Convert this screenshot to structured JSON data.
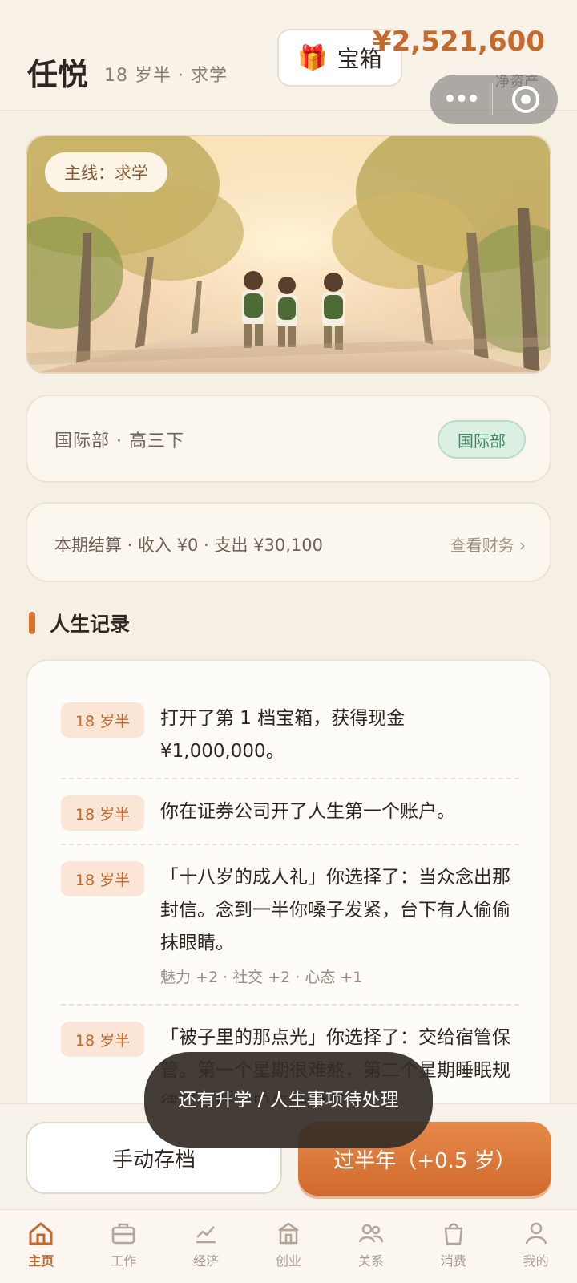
{
  "header": {
    "name": "任悦",
    "subtitle": "18 岁半 · 求学",
    "chest_label": "宝箱",
    "money": "¥2,521,600",
    "hint": "净资产"
  },
  "hero": {
    "tag": "主线：求学"
  },
  "status_card": {
    "text": "国际部 · 高三下",
    "badge": "国际部"
  },
  "finance_card": {
    "text": "本期结算 · 收入 ¥0 · 支出 ¥30,100",
    "link": "查看财务 ›"
  },
  "records": {
    "title": "人生记录",
    "items": [
      {
        "age": "18 岁半",
        "text": "打开了第 1 档宝箱，获得现金 ¥1,000,000。",
        "effect": ""
      },
      {
        "age": "18 岁半",
        "text": "你在证券公司开了人生第一个账户。",
        "effect": ""
      },
      {
        "age": "18 岁半",
        "text": "「十八岁的成人礼」你选择了：当众念出那封信。念到一半你嗓子发紧，台下有人偷偷抹眼睛。",
        "effect": "魅力 +2 · 社交 +2 · 心态 +1"
      },
      {
        "age": "18 岁半",
        "text": "「被子里的那点光」你选择了：交给宿管保管。第一个星期很难熬，第二个星期睡眠规律了，能一口气睡完一整",
        "effect": ""
      }
    ]
  },
  "actions": {
    "save": "手动存档",
    "next": "过半年（+0.5 岁）"
  },
  "toast": "还有升学 / 人生事项待处理",
  "tabs": [
    {
      "label": "主页",
      "icon": "home-icon",
      "active": true
    },
    {
      "label": "工作",
      "icon": "briefcase-icon",
      "active": false
    },
    {
      "label": "经济",
      "icon": "chart-icon",
      "active": false
    },
    {
      "label": "创业",
      "icon": "bank-icon",
      "active": false
    },
    {
      "label": "关系",
      "icon": "people-icon",
      "active": false
    },
    {
      "label": "消费",
      "icon": "shopping-bag-icon",
      "active": false
    },
    {
      "label": "我的",
      "icon": "user-icon",
      "active": false
    }
  ],
  "colors": {
    "accent": "#d9732f",
    "money": "#c46a2a",
    "badge_green": "#3f8a62"
  }
}
